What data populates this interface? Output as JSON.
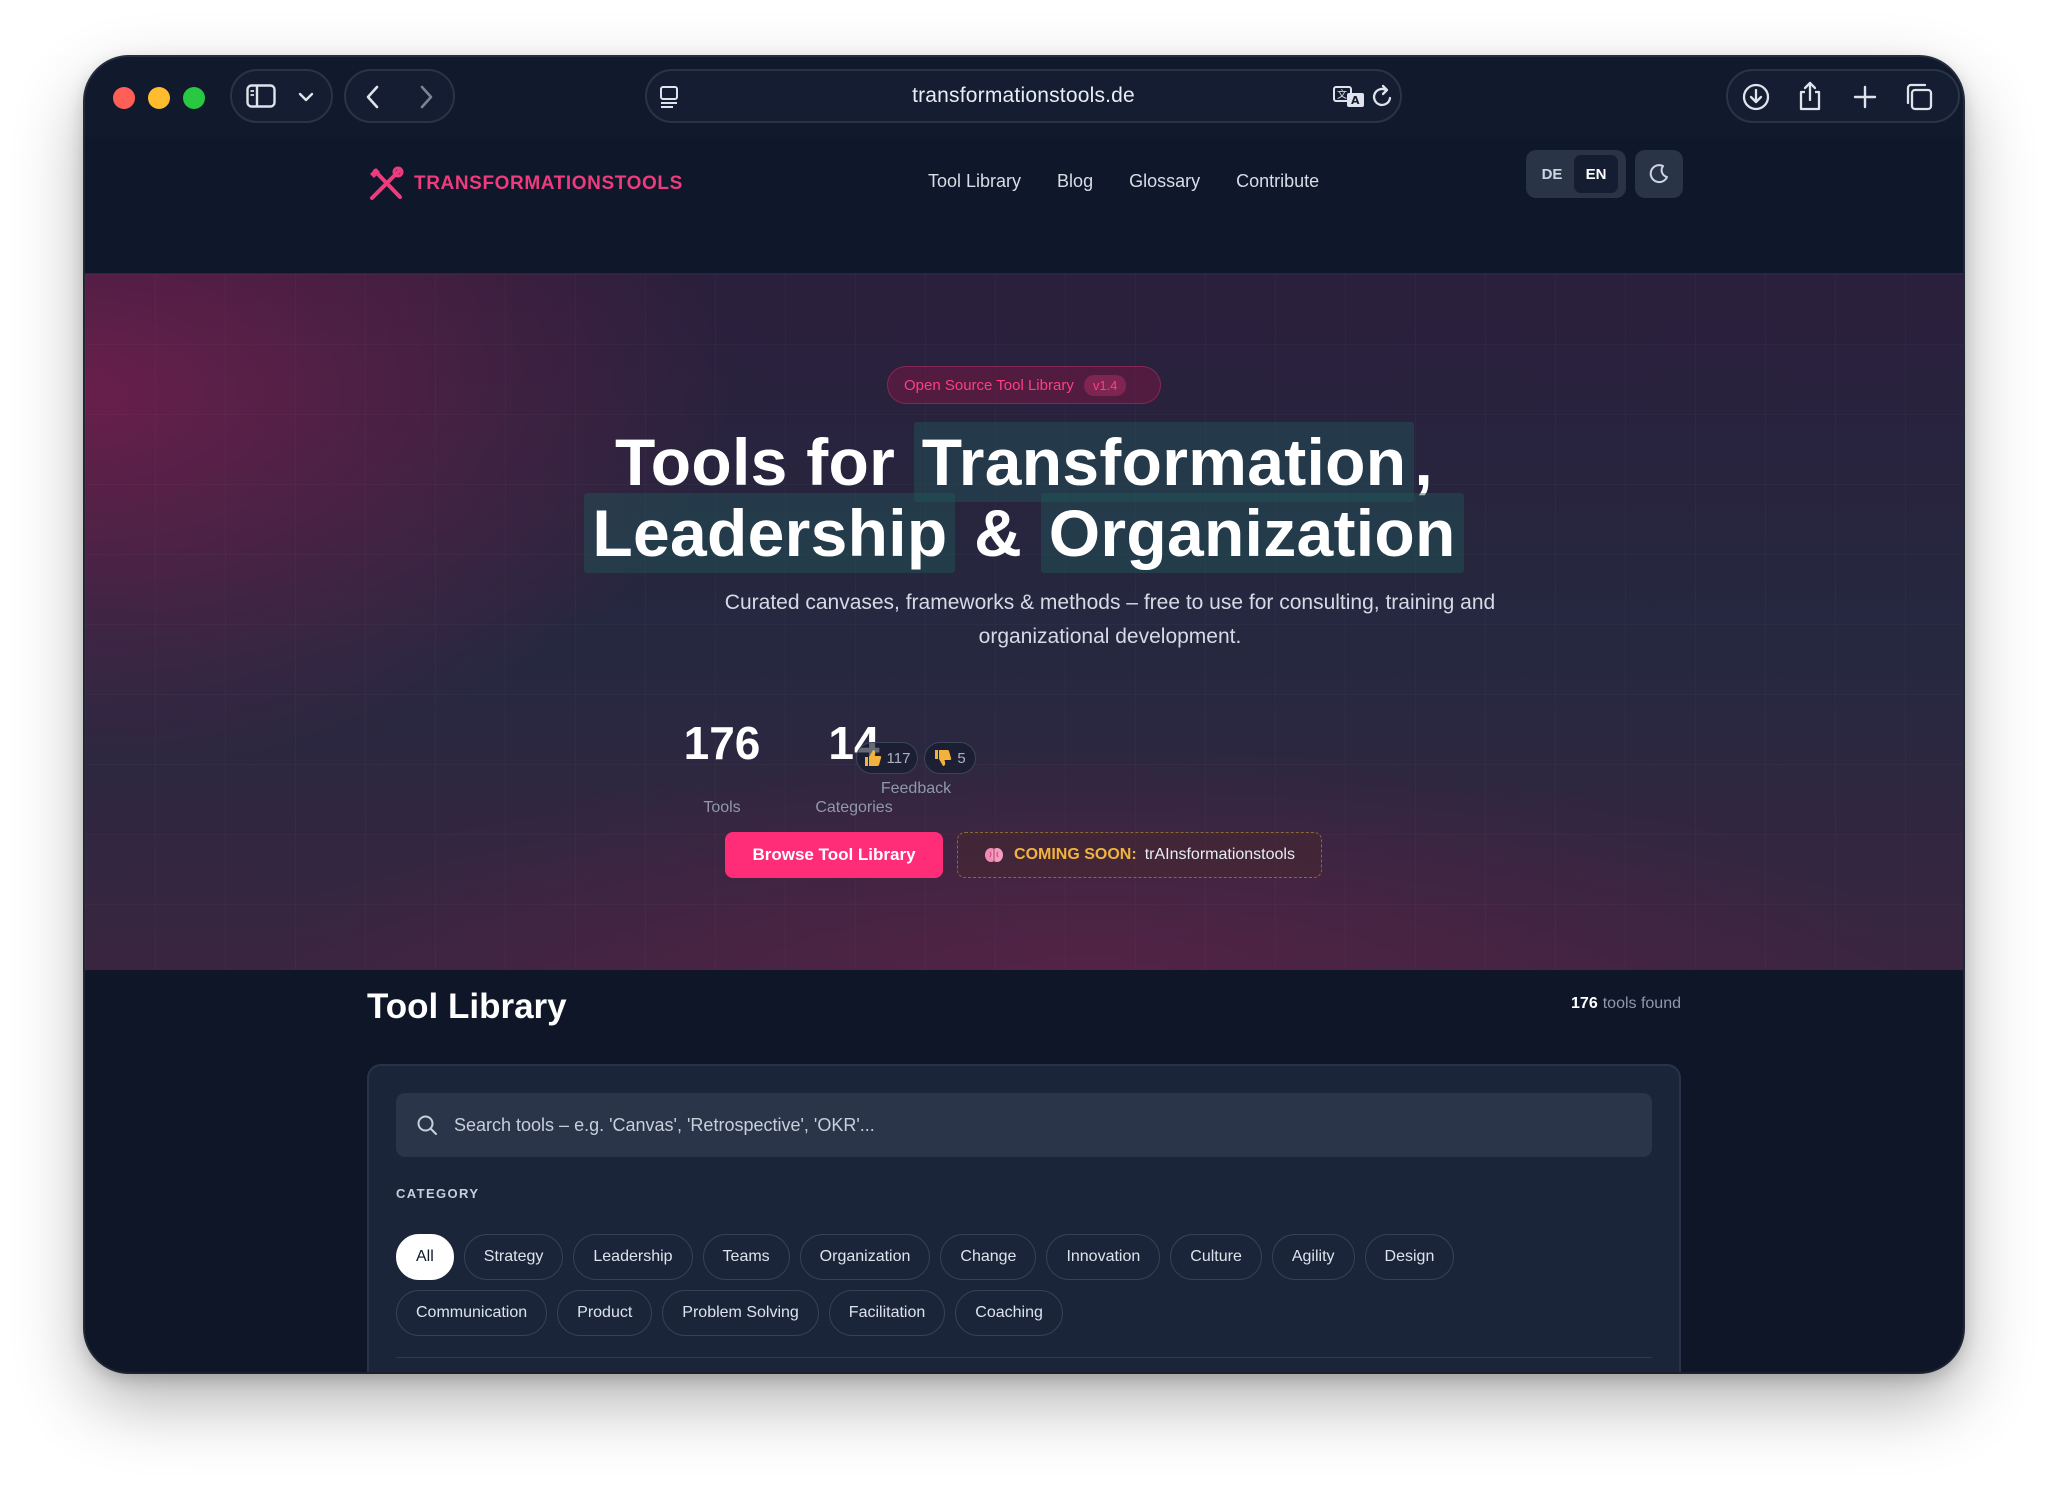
{
  "browser": {
    "url": "transformationstools.de"
  },
  "header": {
    "brand": "TRANSFORMATIONSTOOLS",
    "nav": [
      "Tool Library",
      "Blog",
      "Glossary",
      "Contribute"
    ],
    "languages": [
      "DE",
      "EN"
    ],
    "active_language": "EN"
  },
  "hero": {
    "badge": "Open Source Tool Library",
    "version": "v1.4",
    "title_line1": {
      "pre": "Tools for",
      "highlight": "Transformation",
      "post": ","
    },
    "title_line2": {
      "highlight1": "Leadership",
      "amp": "&",
      "highlight2": "Organization"
    },
    "subtitle": "Curated canvases, frameworks & methods – free to use for consulting, training and organizational development.",
    "stats": [
      {
        "value": "176",
        "label": "Tools"
      },
      {
        "value": "14",
        "label": "Categories"
      }
    ],
    "feedback": {
      "likes": "117",
      "dislikes": "5",
      "label": "Feedback"
    },
    "primary_button": "Browse Tool Library",
    "coming_soon_label": "COMING SOON:",
    "coming_soon_name": "trAInsformationstools"
  },
  "library": {
    "title": "Tool Library",
    "count": "176",
    "count_suffix": "tools found",
    "search_placeholder": "Search tools – e.g. 'Canvas', 'Retrospective', 'OKR'...",
    "category_heading": "CATEGORY",
    "categories_row1": [
      "All",
      "Strategy",
      "Leadership",
      "Teams",
      "Organization",
      "Change",
      "Innovation",
      "Culture",
      "Agility",
      "Design"
    ],
    "categories_row2": [
      "Communication",
      "Product",
      "Problem Solving",
      "Facilitation",
      "Coaching"
    ],
    "active_category": "All"
  },
  "colors": {
    "accent": "#ff2d78",
    "brand": "#ef3b7d",
    "background": "#0f172a",
    "coming_soon": "#f0b43c"
  }
}
